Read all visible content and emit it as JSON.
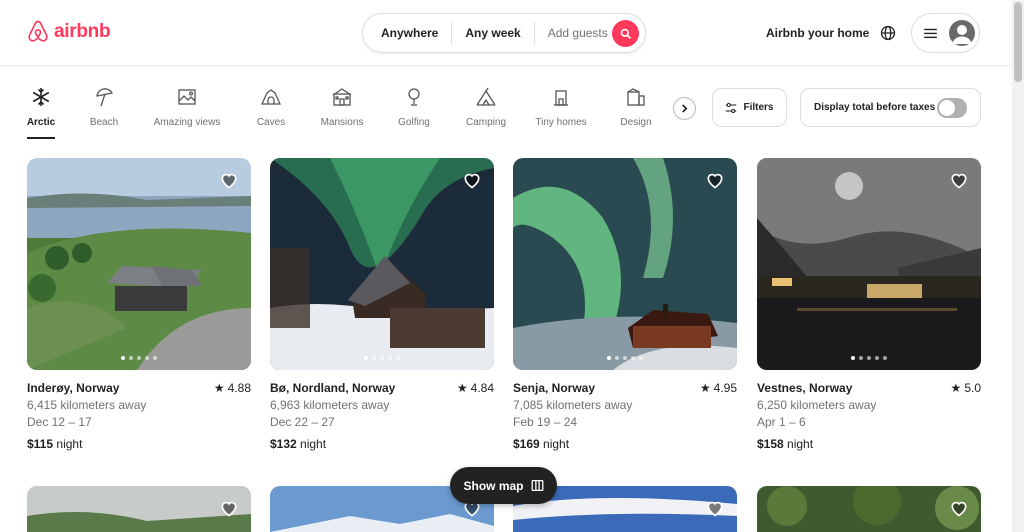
{
  "header": {
    "logo_text": "airbnb",
    "search": {
      "location": "Anywhere",
      "dates": "Any week",
      "guests_placeholder": "Add guests"
    },
    "host_link": "Airbnb your home"
  },
  "categories": [
    {
      "label": "Arctic",
      "icon": "snowflake-icon",
      "active": true
    },
    {
      "label": "Beach",
      "icon": "umbrella-icon"
    },
    {
      "label": "Amazing views",
      "icon": "landscape-icon"
    },
    {
      "label": "Caves",
      "icon": "cave-icon"
    },
    {
      "label": "Mansions",
      "icon": "mansion-icon"
    },
    {
      "label": "Golfing",
      "icon": "golf-icon"
    },
    {
      "label": "Camping",
      "icon": "tent-icon"
    },
    {
      "label": "Tiny homes",
      "icon": "tiny-home-icon"
    },
    {
      "label": "Design",
      "icon": "design-icon"
    }
  ],
  "filters_label": "Filters",
  "taxes_label": "Display total before taxes",
  "listings": [
    {
      "location": "Inderøy, Norway",
      "rating": "4.88",
      "distance": "6,415 kilometers away",
      "dates": "Dec 12 – 17",
      "price": "$115",
      "price_unit": "night"
    },
    {
      "location": "Bø, Nordland, Norway",
      "rating": "4.84",
      "distance": "6,963 kilometers away",
      "dates": "Dec 22 – 27",
      "price": "$132",
      "price_unit": "night"
    },
    {
      "location": "Senja, Norway",
      "rating": "4.95",
      "distance": "7,085 kilometers away",
      "dates": "Feb 19 – 24",
      "price": "$169",
      "price_unit": "night"
    },
    {
      "location": "Vestnes, Norway",
      "rating": "5.0",
      "distance": "6,250 kilometers away",
      "dates": "Apr 1 – 6",
      "price": "$158",
      "price_unit": "night"
    }
  ],
  "show_map_label": "Show map",
  "colors": {
    "brand": "#ff385c",
    "text": "#222222",
    "muted": "#717171"
  }
}
